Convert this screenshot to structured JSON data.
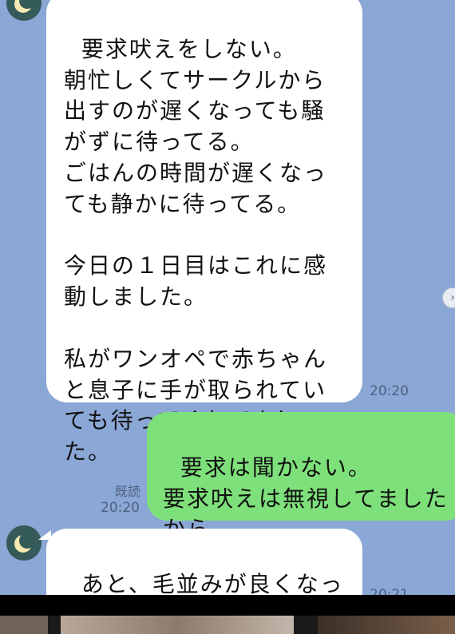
{
  "messages": [
    {
      "side": "incoming",
      "text": "要求吠えをしない。\n朝忙しくてサークルから出すのが遅くなっても騒がずに待ってる。\nごはんの時間が遅くなっても静かに待ってる。\n\n今日の１日目はこれに感動しました。\n\n私がワンオペで赤ちゃんと息子に手が取られていても待ってくれてました。",
      "time": "20:20"
    },
    {
      "side": "outgoing",
      "text": "要求は聞かない。\n要求吠えは無視してましたから",
      "read": "既読",
      "time": "20:20"
    },
    {
      "side": "incoming",
      "text": "あと、毛並みが良くなってます。",
      "time": "20:21"
    }
  ],
  "avatar_icon": "crescent-moon-icon",
  "colors": {
    "background": "#8aa7d6",
    "incoming_bubble": "#ffffff",
    "outgoing_bubble": "#7ee07a"
  }
}
